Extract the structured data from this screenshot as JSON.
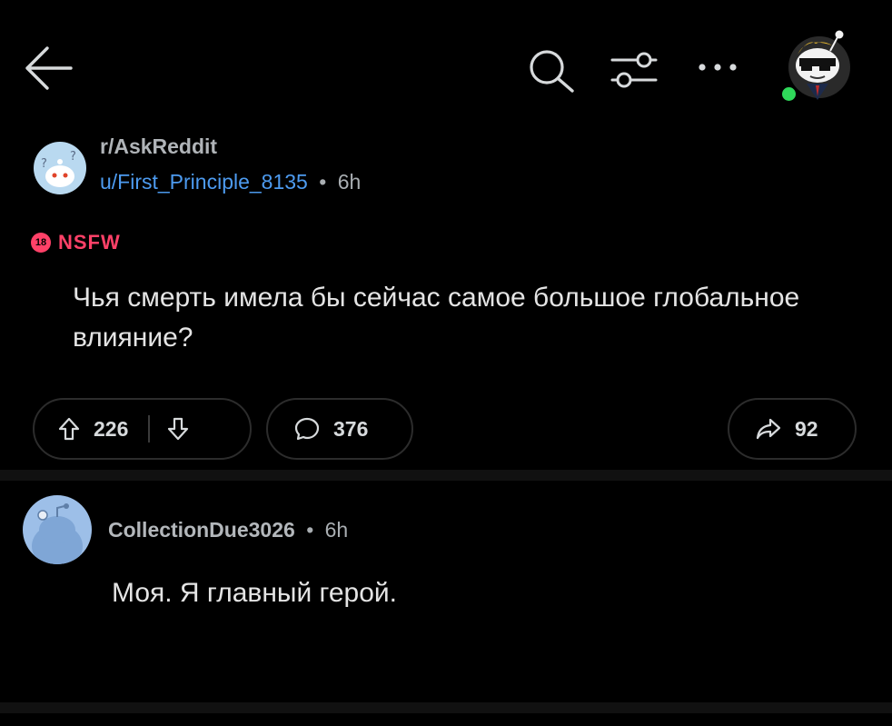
{
  "header": {
    "back_icon": "arrow-left-icon",
    "search_icon": "search-icon",
    "filter_icon": "sliders-icon",
    "more_icon": "more-horizontal-icon",
    "avatar": "user-avatar-snoo",
    "online_color": "#2fd85a"
  },
  "post": {
    "community": "r/AskReddit",
    "author": "u/First_Principle_8135",
    "separator": "•",
    "age": "6h",
    "nsfw_badge": "18",
    "nsfw_label": "NSFW",
    "title": "Чья смерть имела бы сейчас самое большое глобальное влияние?",
    "upvotes": "226",
    "comments": "376",
    "shares": "92"
  },
  "comment": {
    "author": "CollectionDue3026",
    "separator": "•",
    "age": "6h",
    "body": "Моя. Я главный герой."
  },
  "colors": {
    "background": "#000000",
    "username_blue": "#4d9bf0",
    "nsfw_red": "#ff4168",
    "muted_text": "#a9aeb2"
  }
}
